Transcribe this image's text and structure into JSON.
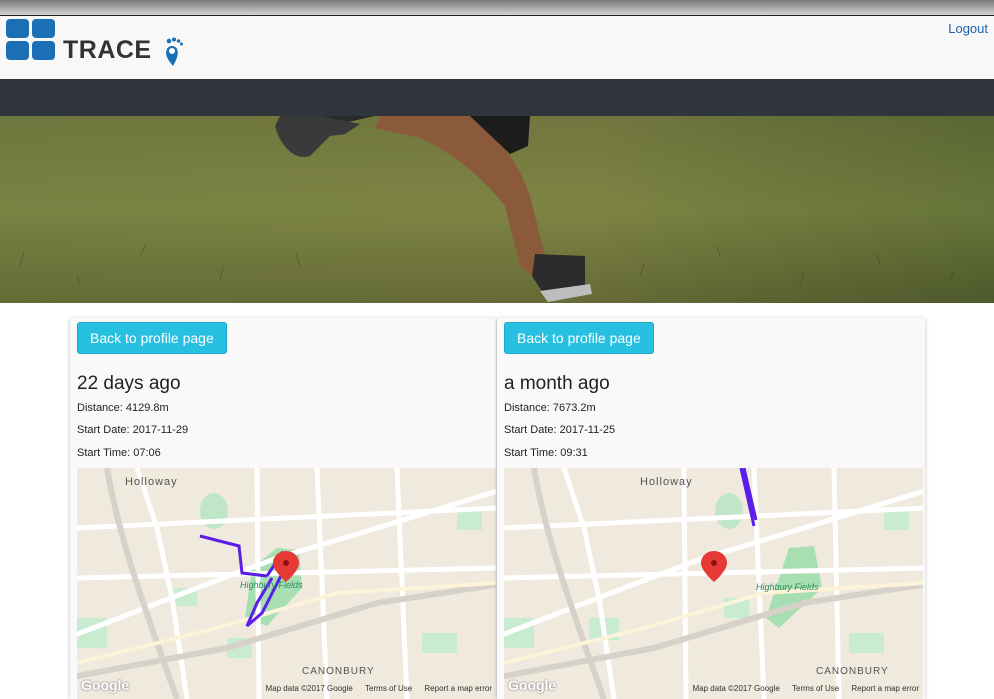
{
  "header": {
    "brand": "TRACE",
    "logout_label": "Logout"
  },
  "runs": [
    {
      "back_label": "Back to profile page",
      "when": "22 days ago",
      "distance": "Distance: 4129.8m",
      "start_date": "Start Date: 2017-11-29",
      "start_time": "Start Time: 07:06"
    },
    {
      "back_label": "Back to profile page",
      "when": "a month ago",
      "distance": "Distance: 7673.2m",
      "start_date": "Start Date: 2017-11-25",
      "start_time": "Start Time: 09:31"
    }
  ],
  "map": {
    "labels": [
      "Holloway",
      "Highbury Fields",
      "CANONBURY"
    ],
    "google": "Google",
    "map_data": "Map data ©2017 Google",
    "terms": "Terms of Use",
    "report": "Report a map error",
    "route_color": "#5a1ee8",
    "marker_color": "#e53935"
  },
  "colors": {
    "accent": "#27c0e0",
    "navbar": "#2f353a",
    "brand_blue": "#1a6fb5"
  }
}
